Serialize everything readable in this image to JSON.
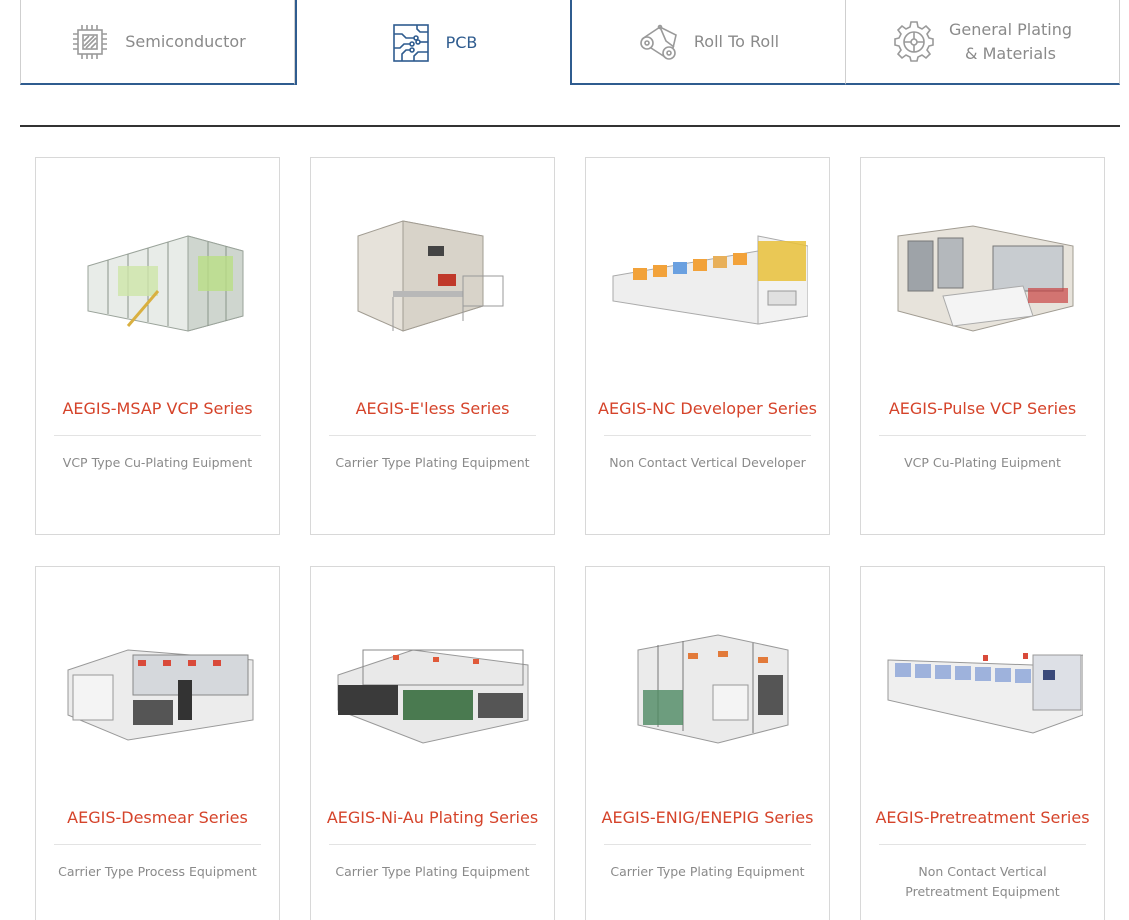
{
  "tabs": [
    {
      "label": "Semiconductor",
      "icon": "chip-icon",
      "active": false
    },
    {
      "label": "PCB",
      "icon": "circuit-board-icon",
      "active": true
    },
    {
      "label": "Roll To Roll",
      "icon": "roller-icon",
      "active": false
    },
    {
      "label": "General Plating & Materials",
      "label_line1": "General Plating",
      "label_line2": "& Materials",
      "icon": "gear-icon",
      "active": false
    }
  ],
  "colors": {
    "accent": "#2f5c8f",
    "title": "#d5432a",
    "muted": "#8a8a8a"
  },
  "products": [
    {
      "title": "AEGIS-MSAP VCP Series",
      "desc": "VCP Type Cu-Plating Euipment"
    },
    {
      "title": "AEGIS-E'less Series",
      "desc": "Carrier Type Plating Equipment"
    },
    {
      "title": "AEGIS-NC Developer Series",
      "desc": "Non Contact Vertical Developer"
    },
    {
      "title": "AEGIS-Pulse VCP Series",
      "desc": "VCP Cu-Plating Euipment"
    },
    {
      "title": "AEGIS-Desmear Series",
      "desc": "Carrier Type Process Equipment"
    },
    {
      "title": "AEGIS-Ni-Au Plating Series",
      "desc": "Carrier Type Plating Equipment"
    },
    {
      "title": "AEGIS-ENIG/ENEPIG Series",
      "desc": "Carrier Type Plating Equipment"
    },
    {
      "title": "AEGIS-Pretreatment Series",
      "desc": "Non Contact Vertical Pretreatment Equipment"
    }
  ]
}
